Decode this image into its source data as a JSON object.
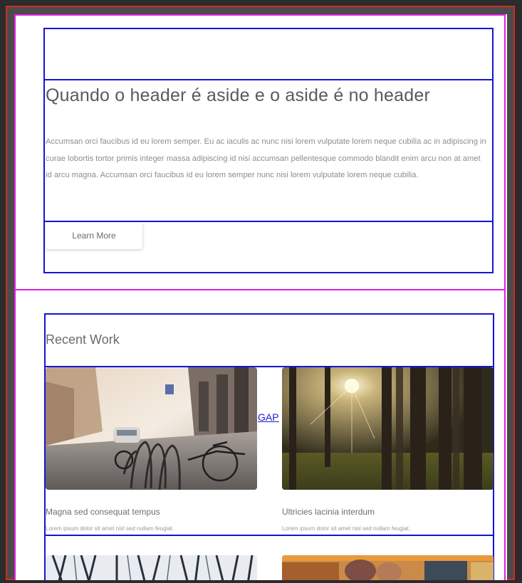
{
  "header": {
    "title": "Quando o header é aside e o aside é no header",
    "body": "Accumsan orci faucibus id eu lorem semper. Eu ac iaculis ac nunc nisi lorem vulputate lorem neque cubilia ac in adipiscing in curae lobortis tortor primis integer massa adipiscing id nisi accumsan pellentesque commodo blandit enim arcu non at amet id arcu magna. Accumsan orci faucibus id eu lorem semper nunc nisi lorem vulputate lorem neque cubilia.",
    "button_label": "Learn More"
  },
  "recent_work": {
    "title": "Recent Work",
    "gap_label": "GAP",
    "cards": [
      {
        "title": "Magna sed consequat tempus",
        "subtitle": "Lorem ipsum dolor sit amet nisl sed nullam feugiat.",
        "image": "city-street-bicycles"
      },
      {
        "title": "Ultricies lacinia interdum",
        "subtitle": "Lorem ipsum dolor sit amet nisl sed nullam feugiat.",
        "image": "sunlit-forest"
      },
      {
        "title": "",
        "subtitle": "",
        "image": "architecture-lines"
      },
      {
        "title": "",
        "subtitle": "",
        "image": "colorful-objects"
      }
    ]
  },
  "colors": {
    "section_outline": "#e21ee6",
    "box_outline": "#1515d6",
    "frame_outline": "#d42a22"
  }
}
